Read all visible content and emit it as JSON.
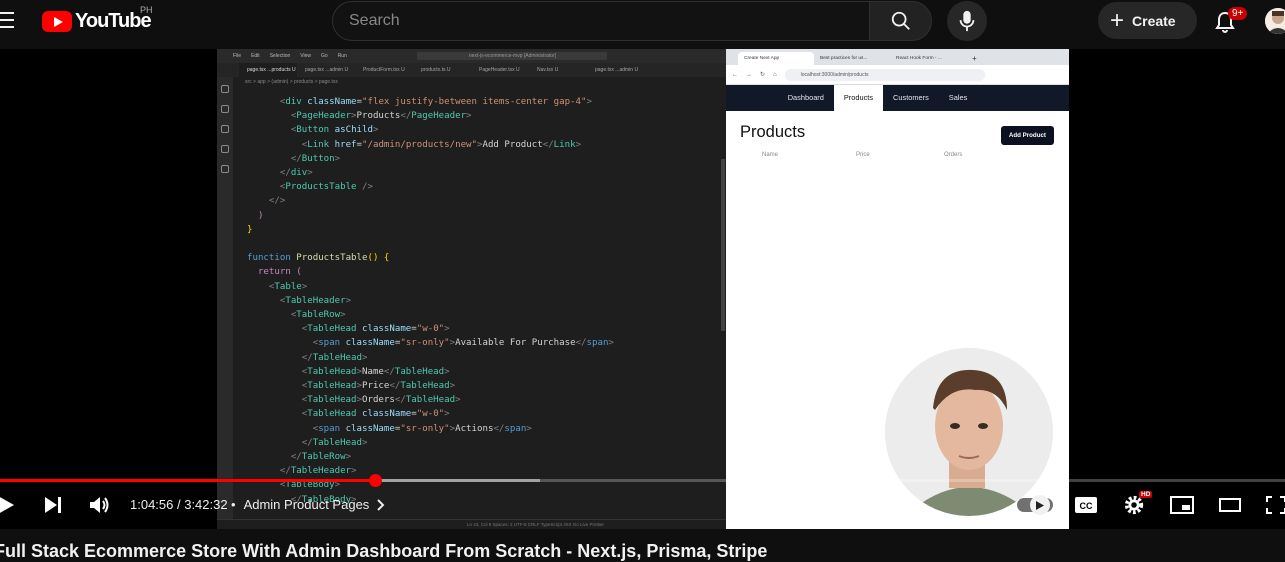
{
  "header": {
    "logo_text": "YouTube",
    "region": "PH",
    "search_placeholder": "Search",
    "create_label": "Create",
    "notification_count": "9+"
  },
  "editor": {
    "title_items": [
      "File",
      "Edit",
      "Selection",
      "View",
      "Go",
      "Run",
      "←",
      "→"
    ],
    "search_text": "next-js-ecommerce-mvp [Administrator]",
    "tabs": [
      "page.tsx ...products U",
      "page.tsx ...admin U",
      "ProductForm.tsx U",
      "products.ts U",
      "PageHeader.tsx U",
      "Nav.tsx U",
      "page.tsx ...admin U"
    ],
    "breadcrumb": "src > app > (admin) > products > page.tsx",
    "status_text": "Ln 43, Col 9   Spaces: 2   UTF-8   CRLF   TypeScript JSX   Go Live   Prettier"
  },
  "browser": {
    "tabs": [
      "Create Next App",
      "Best practices for us...",
      "React Hook Form - ..."
    ],
    "url": "localhost:3000/admin/products",
    "nav": [
      "Dashboard",
      "Products",
      "Customers",
      "Sales"
    ],
    "active_nav": "Products",
    "page_title": "Products",
    "add_button": "Add Product",
    "columns": [
      "Name",
      "Price",
      "Orders"
    ]
  },
  "player": {
    "current_time": "1:04:56",
    "separator": " / ",
    "duration": "3:42:32",
    "chapter_dot": "•",
    "chapter": "Admin Product Pages",
    "progress": 0.2919,
    "buffered": 0.42
  },
  "video": {
    "title": "Full Stack Ecommerce Store With Admin Dashboard From Scratch - Next.js, Prisma, Stripe"
  }
}
